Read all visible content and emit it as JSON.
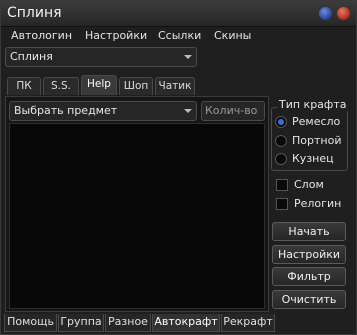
{
  "window": {
    "title": "Сплиня"
  },
  "menu": {
    "items": [
      "Автологин",
      "Настройки",
      "Ссылки",
      "Скины"
    ]
  },
  "profile_combo": {
    "value": "Сплиня"
  },
  "top_tabs": [
    "ПК",
    "S.S.",
    "Help",
    "Шоп",
    "Чатик"
  ],
  "active_top_tab": "Help",
  "item_combo": {
    "value": "Выбрать предмет"
  },
  "quantity": {
    "placeholder": "Колич-во"
  },
  "craft_type": {
    "title": "Тип крафта",
    "options": [
      "Ремесло",
      "Портной",
      "Кузнец"
    ],
    "selected": "Ремесло"
  },
  "checks": {
    "slom": "Слом",
    "relogin": "Релогин"
  },
  "buttons": {
    "start": "Начать",
    "settings": "Настройки",
    "filter": "Фильтр",
    "clear": "Очистить"
  },
  "bottom_tabs": [
    "Помощь",
    "Группа",
    "Разное",
    "Автокрафт",
    "Рекрафт"
  ],
  "active_bottom_tab": "Автокрафт",
  "colors": {
    "accent": "#3a6fd8",
    "close": "#b8321f",
    "minimize": "#2b4aa8"
  }
}
